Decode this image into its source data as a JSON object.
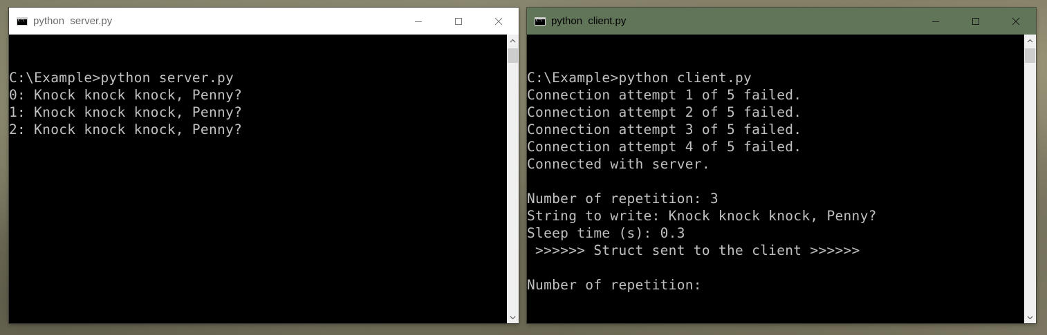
{
  "server_window": {
    "title": "python  server.py",
    "icon": "console-icon",
    "lines": [
      "",
      "C:\\Example>python server.py",
      "0: Knock knock knock, Penny?",
      "1: Knock knock knock, Penny?",
      "2: Knock knock knock, Penny?"
    ]
  },
  "client_window": {
    "title": "python  client.py",
    "icon": "console-icon",
    "lines": [
      "",
      "C:\\Example>python client.py",
      "Connection attempt 1 of 5 failed.",
      "Connection attempt 2 of 5 failed.",
      "Connection attempt 3 of 5 failed.",
      "Connection attempt 4 of 5 failed.",
      "Connected with server.",
      "",
      "Number of repetition: 3",
      "String to write: Knock knock knock, Penny?",
      "Sleep time (s): 0.3",
      " >>>>>> Struct sent to the client >>>>>>",
      "",
      "Number of repetition:"
    ]
  },
  "colors": {
    "terminal_bg": "#000000",
    "terminal_text": "#c0c0c0",
    "active_titlebar": "#617559",
    "inactive_titlebar": "#ffffff"
  }
}
